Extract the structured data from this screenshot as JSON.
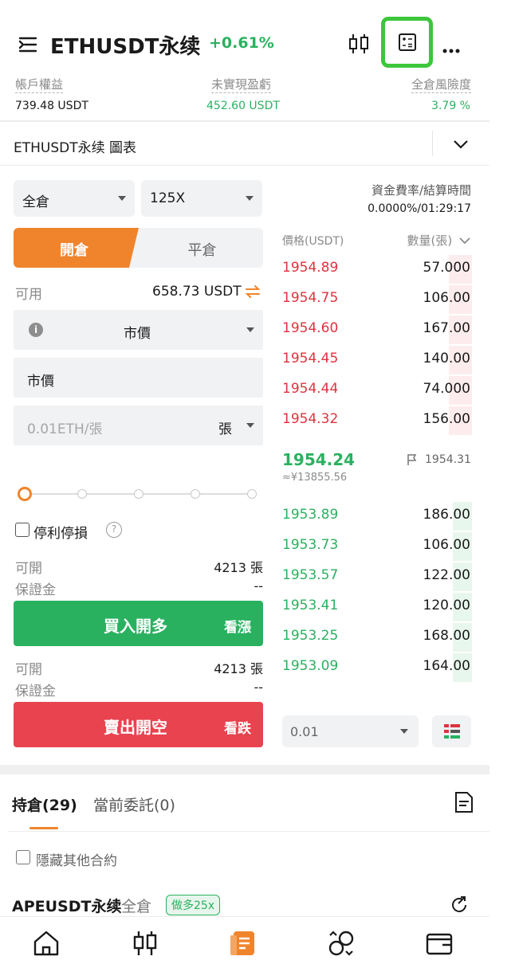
{
  "header": {
    "title": "ETHUSDT永续",
    "change": "+0.61%"
  },
  "account": {
    "equity_label": "帳戶權益",
    "equity_value": "739.48 USDT",
    "unrealized_label": "未實現盈虧",
    "unrealized_value": "452.60 USDT",
    "risk_label": "全倉風險度",
    "risk_value": "3.79 %"
  },
  "chart_toggle": {
    "label": "ETHUSDT永续 圖表"
  },
  "trade": {
    "margin_mode": "全倉",
    "leverage": "125X",
    "tab_open": "開倉",
    "tab_close": "平倉",
    "available_label": "可用",
    "available_value": "658.73 USDT",
    "order_type": "市價",
    "price_field": "市價",
    "amount_placeholder": "0.01ETH/張",
    "amount_unit": "張",
    "tpsl_label": "停利停損",
    "long_open_label": "可開",
    "long_open_value": "4213 張",
    "long_margin_label": "保證金",
    "long_margin_value": "--",
    "buy_label": "買入開多",
    "buy_sub": "看漲",
    "short_open_label": "可開",
    "short_open_value": "4213 張",
    "short_margin_label": "保證金",
    "short_margin_value": "--",
    "sell_label": "賣出開空",
    "sell_sub": "看跌"
  },
  "orderbook": {
    "funding_label": "資金費率/結算時間",
    "funding_value": "0.0000%/01:29:17",
    "price_header": "價格(USDT)",
    "qty_header": "數量(張)",
    "asks": [
      {
        "price": "1954.89",
        "qty": "57.000",
        "depth": 0.12
      },
      {
        "price": "1954.75",
        "qty": "106.00",
        "depth": 0.12
      },
      {
        "price": "1954.60",
        "qty": "167.00",
        "depth": 0.12
      },
      {
        "price": "1954.45",
        "qty": "140.00",
        "depth": 0.12
      },
      {
        "price": "1954.44",
        "qty": "74.000",
        "depth": 0.12
      },
      {
        "price": "1954.32",
        "qty": "156.00",
        "depth": 0.12
      }
    ],
    "last_price": "1954.24",
    "last_price_cny": "≈¥13855.56",
    "mark_price": "1954.31",
    "bids": [
      {
        "price": "1953.89",
        "qty": "186.00",
        "depth": 0.1
      },
      {
        "price": "1953.73",
        "qty": "106.00",
        "depth": 0.1
      },
      {
        "price": "1953.57",
        "qty": "122.00",
        "depth": 0.1
      },
      {
        "price": "1953.41",
        "qty": "120.00",
        "depth": 0.1
      },
      {
        "price": "1953.25",
        "qty": "168.00",
        "depth": 0.1
      },
      {
        "price": "1953.09",
        "qty": "164.00",
        "depth": 0.1
      }
    ],
    "precision": "0.01"
  },
  "positions": {
    "tab_positions": "持倉(29)",
    "tab_orders": "當前委託(0)",
    "hide_others": "隱藏其他合約",
    "first_symbol": "APEUSDT永续",
    "first_mode": "全倉",
    "first_badge": "做多25x"
  },
  "colors": {
    "green": "#2ab160",
    "red": "#e0323f",
    "orange": "#f0842c",
    "highlight": "#3cc63c"
  }
}
